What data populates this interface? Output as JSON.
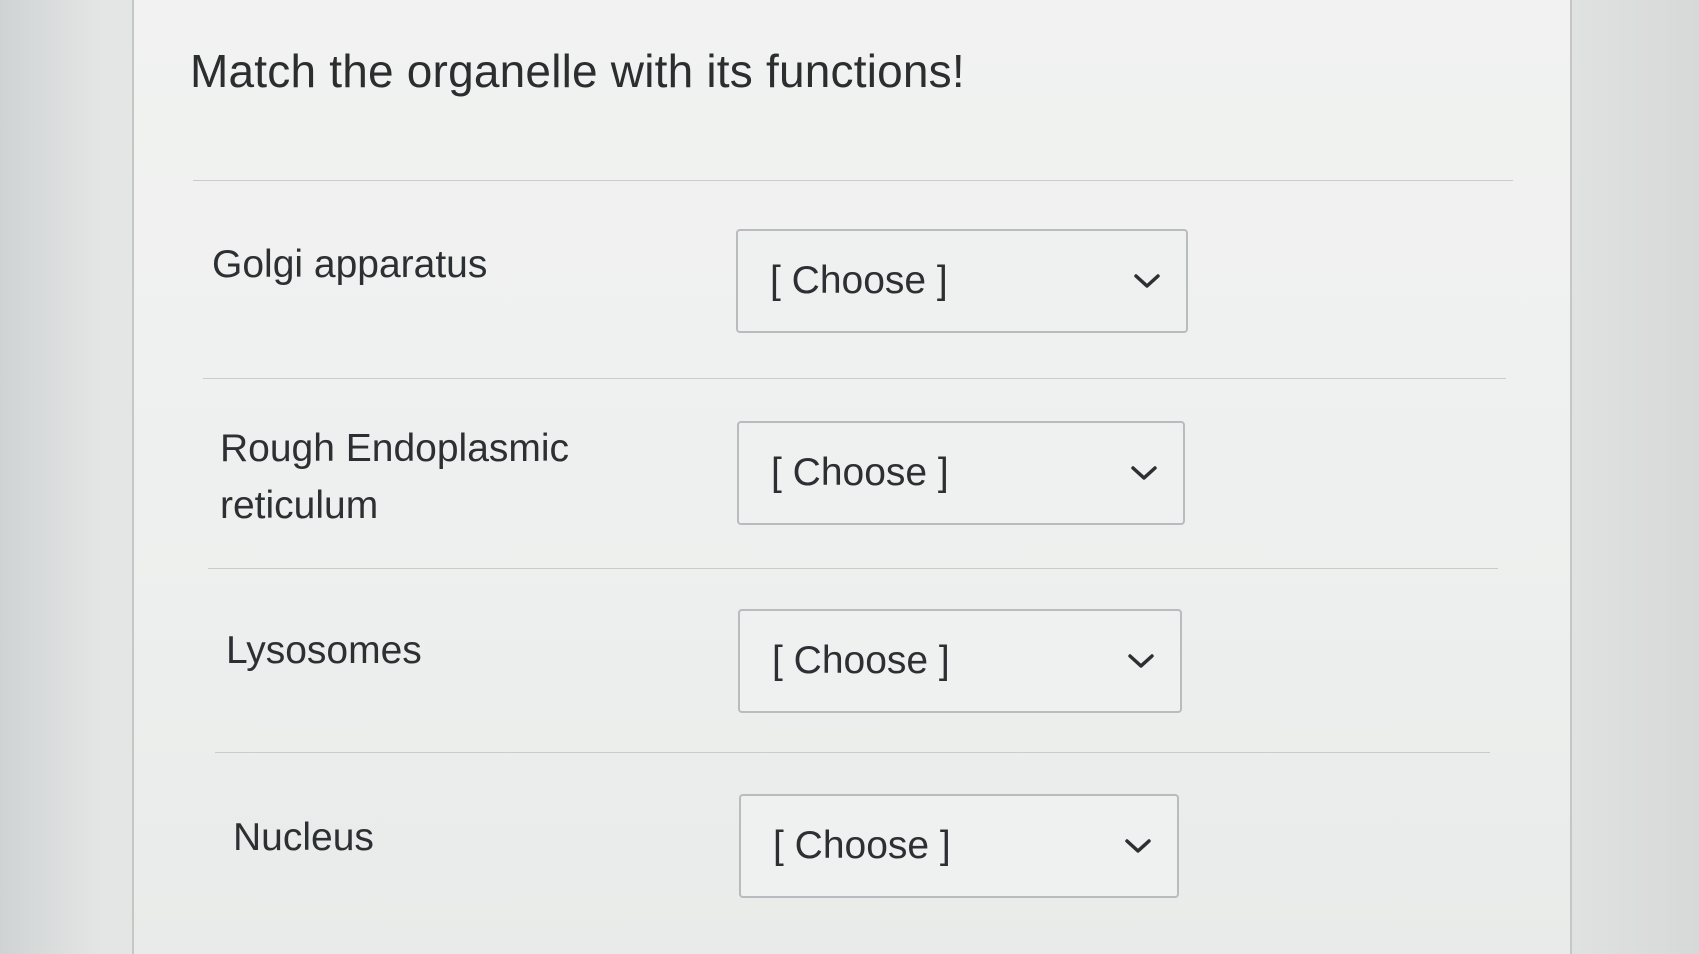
{
  "question": {
    "title": "Match the organelle  with its functions!"
  },
  "matches": [
    {
      "label": "Golgi apparatus",
      "selected": "[ Choose ]"
    },
    {
      "label": "Rough Endoplasmic\nreticulum",
      "selected": "[ Choose ]"
    },
    {
      "label": "Lysosomes",
      "selected": "[ Choose ]"
    },
    {
      "label": "Nucleus",
      "selected": "[ Choose ]"
    }
  ],
  "icons": {
    "dropdown": "chevron-down-icon"
  },
  "colors": {
    "text": "#2d3033",
    "border": "#b8bcbe",
    "panel": "#eff1f0"
  }
}
